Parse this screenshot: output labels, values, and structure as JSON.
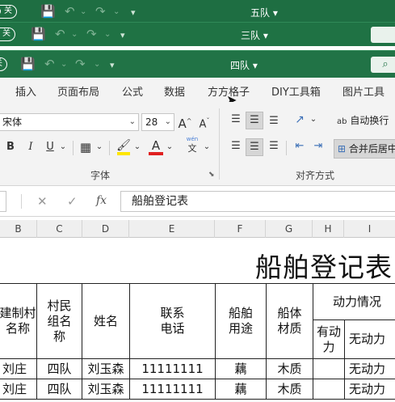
{
  "windows": [
    {
      "toggle": "关",
      "title": "五队"
    },
    {
      "toggle": "关",
      "title": "三队"
    },
    {
      "toggle": "关",
      "title": "四队"
    }
  ],
  "ribbon": {
    "tabs": [
      "插入",
      "页面布局",
      "公式",
      "数据",
      "方方格子",
      "DIY工具箱",
      "图片工具"
    ],
    "font_name": "宋体",
    "font_size": "28",
    "grow_font": "A",
    "shrink_font": "A",
    "bold": "B",
    "italic": "I",
    "underline": "U",
    "wen_text": "wén",
    "wen_char": "文",
    "wrap_label": "自动换行",
    "wrap_icon_text": "ab",
    "merge_label": "合并后居中",
    "group_font": "字体",
    "group_align": "对齐方式"
  },
  "formula_bar": {
    "cancel": "✕",
    "confirm": "✓",
    "fx": "fx",
    "value": "船舶登记表"
  },
  "columns": [
    "B",
    "C",
    "D",
    "E",
    "F",
    "G",
    "H",
    "I"
  ],
  "sheet": {
    "title": "船舶登记表",
    "headers": {
      "village": "建制村名称",
      "group": "村民组名称",
      "name": "姓名",
      "phone": "联系电话",
      "use": "船舶用途",
      "material": "船体材质",
      "power": "动力情况",
      "powered": "有动力",
      "unpowered": "无动力"
    },
    "rows": [
      {
        "village": "刘庄",
        "group": "四队",
        "name": "刘玉森",
        "phone": "11111111",
        "use": "藕",
        "material": "木质",
        "powered": "",
        "unpowered": "无动力"
      },
      {
        "village": "刘庄",
        "group": "四队",
        "name": "刘玉森",
        "phone": "11111111",
        "use": "藕",
        "material": "木质",
        "powered": "",
        "unpowered": "无动力"
      }
    ]
  },
  "colors": {
    "excel_green": "#217346",
    "ribbon_bg": "#f3f3f3",
    "font_color_bar": "#e02020",
    "highlight_bar": "#ffe600"
  }
}
